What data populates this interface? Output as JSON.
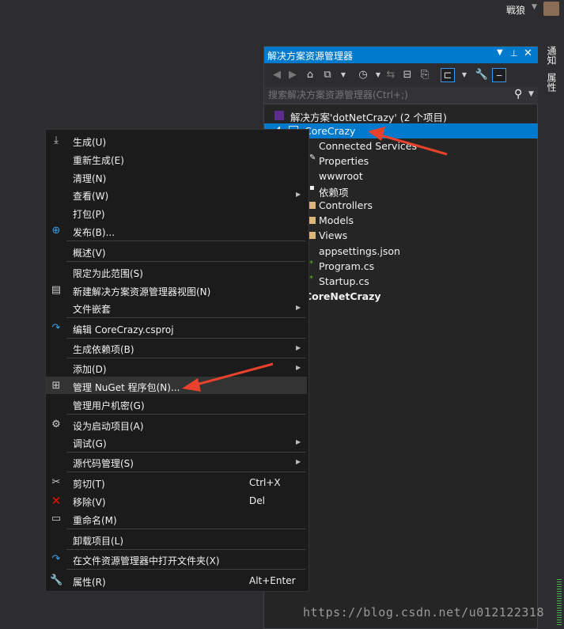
{
  "user": {
    "name": "戦狼"
  },
  "side_tabs": [
    "通知",
    "属性"
  ],
  "solution_explorer": {
    "title": "解决方案资源管理器",
    "search_placeholder": "搜索解决方案资源管理器(Ctrl+;)",
    "tree": [
      {
        "label": "解决方案'dotNetCrazy' (2 个项目)",
        "icon": "solution-icon"
      },
      {
        "label": "CoreCrazy",
        "icon": "web-project-icon",
        "selected": true
      },
      {
        "label": "Connected Services",
        "icon": "connected-services-icon"
      },
      {
        "label": "Properties",
        "icon": "wrench-icon"
      },
      {
        "label": "wwwroot",
        "icon": "globe-icon"
      },
      {
        "label": "依赖项",
        "icon": "dependencies-icon"
      },
      {
        "label": "Controllers",
        "icon": "folder-icon"
      },
      {
        "label": "Models",
        "icon": "folder-icon"
      },
      {
        "label": "Views",
        "icon": "folder-icon"
      },
      {
        "label": "appsettings.json",
        "icon": "json-file-icon"
      },
      {
        "label": "Program.cs",
        "icon": "csharp-file-icon"
      },
      {
        "label": "Startup.cs",
        "icon": "csharp-file-icon"
      },
      {
        "label": "CoreNetCrazy",
        "icon": "project-icon"
      }
    ]
  },
  "context_menu": {
    "items": [
      {
        "label": "生成(U)",
        "icon": "build-icon"
      },
      {
        "label": "重新生成(E)"
      },
      {
        "label": "清理(N)"
      },
      {
        "label": "查看(W)",
        "submenu": true
      },
      {
        "label": "打包(P)"
      },
      {
        "label": "发布(B)...",
        "icon": "globe-publish-icon"
      },
      {
        "label": "概述(V)"
      },
      {
        "label": "限定为此范围(S)"
      },
      {
        "label": "新建解决方案资源管理器视图(N)",
        "icon": "new-view-icon"
      },
      {
        "label": "文件嵌套",
        "submenu": true
      },
      {
        "label": "编辑 CoreCrazy.csproj",
        "icon": "edit-arrow-icon"
      },
      {
        "label": "生成依赖项(B)",
        "submenu": true
      },
      {
        "label": "添加(D)",
        "submenu": true
      },
      {
        "label": "管理 NuGet 程序包(N)...",
        "icon": "nuget-package-icon",
        "highlighted": true
      },
      {
        "label": "管理用户机密(G)"
      },
      {
        "label": "设为启动项目(A)",
        "icon": "gear-icon"
      },
      {
        "label": "调试(G)",
        "submenu": true
      },
      {
        "label": "源代码管理(S)",
        "submenu": true
      },
      {
        "label": "剪切(T)",
        "icon": "scissors-icon",
        "shortcut": "Ctrl+X"
      },
      {
        "label": "移除(V)",
        "icon": "close-red-icon",
        "shortcut": "Del"
      },
      {
        "label": "重命名(M)",
        "icon": "rename-icon"
      },
      {
        "label": "卸载项目(L)"
      },
      {
        "label": "在文件资源管理器中打开文件夹(X)",
        "icon": "open-folder-arrow-icon"
      },
      {
        "label": "属性(R)",
        "icon": "wrench-icon",
        "shortcut": "Alt+Enter"
      }
    ]
  },
  "watermark": "https://blog.csdn.net/u012122318",
  "colors": {
    "accent": "#007acc",
    "background": "#2d2d30",
    "menu_bg": "#1b1b1c",
    "arrow": "#e8412c"
  }
}
